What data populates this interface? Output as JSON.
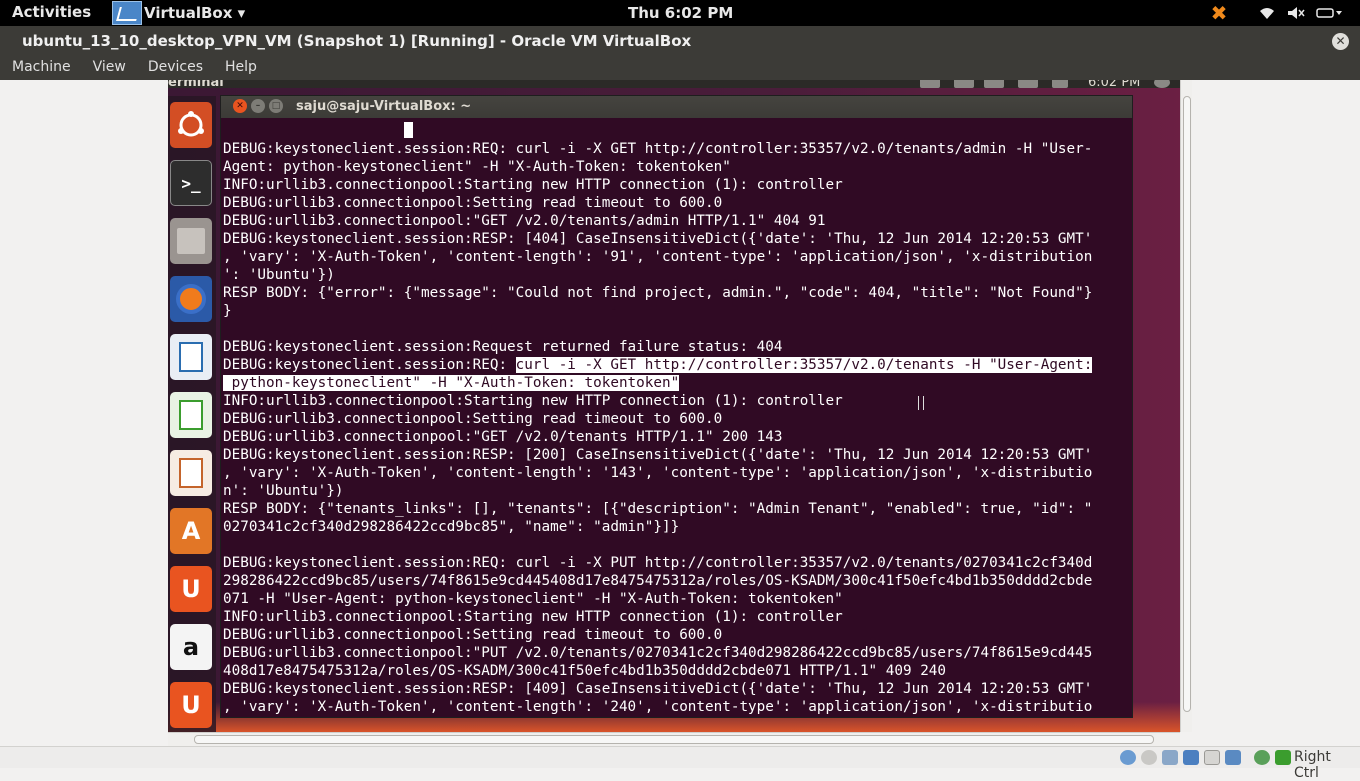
{
  "host_topbar": {
    "activities": "Activities",
    "app_name": "VirtualBox ▾",
    "clock": "Thu  6:02 PM"
  },
  "vbox_window": {
    "title": "ubuntu_13_10_desktop_VPN_VM (Snapshot 1) [Running] - Oracle VM VirtualBox",
    "close_glyph": "✕",
    "menu": [
      "Machine",
      "View",
      "Devices",
      "Help"
    ]
  },
  "guest": {
    "panel_text": "erminal",
    "clock": "6:02 PM",
    "launcher_icons": [
      "ubuntu-dash-icon",
      "terminal-icon",
      "files-icon",
      "firefox-icon",
      "writer-icon",
      "calc-icon",
      "impress-icon",
      "software-center-icon",
      "ubuntu-one-icon",
      "amazon-icon",
      "ubuntu-one-music-icon"
    ]
  },
  "terminal": {
    "title": "saju@saju-VirtualBox: ~",
    "close_glyph": "✕",
    "min_glyph": "–",
    "max_glyph": "□",
    "lines": [
      "DEBUG:keystoneclient.session:REQ: curl -i -X GET http://controller:35357/v2.0/tenants/admin -H \"User-",
      "Agent: python-keystoneclient\" -H \"X-Auth-Token: tokentoken\"",
      "INFO:urllib3.connectionpool:Starting new HTTP connection (1): controller",
      "DEBUG:urllib3.connectionpool:Setting read timeout to 600.0",
      "DEBUG:urllib3.connectionpool:\"GET /v2.0/tenants/admin HTTP/1.1\" 404 91",
      "DEBUG:keystoneclient.session:RESP: [404] CaseInsensitiveDict({'date': 'Thu, 12 Jun 2014 12:20:53 GMT'",
      ", 'vary': 'X-Auth-Token', 'content-length': '91', 'content-type': 'application/json', 'x-distribution",
      "': 'Ubuntu'})",
      "RESP BODY: {\"error\": {\"message\": \"Could not find project, admin.\", \"code\": 404, \"title\": \"Not Found\"}",
      "}",
      "",
      "DEBUG:keystoneclient.session:Request returned failure status: 404"
    ],
    "highlight_prefix": "DEBUG:keystoneclient.session:REQ: ",
    "highlight_1": "curl -i -X GET http://controller:35357/v2.0/tenants -H \"User-Agent:",
    "highlight_2": " python-keystoneclient\" -H \"X-Auth-Token: tokentoken\"",
    "lines_after": [
      "INFO:urllib3.connectionpool:Starting new HTTP connection (1): controller",
      "DEBUG:urllib3.connectionpool:Setting read timeout to 600.0",
      "DEBUG:urllib3.connectionpool:\"GET /v2.0/tenants HTTP/1.1\" 200 143",
      "DEBUG:keystoneclient.session:RESP: [200] CaseInsensitiveDict({'date': 'Thu, 12 Jun 2014 12:20:53 GMT'",
      ", 'vary': 'X-Auth-Token', 'content-length': '143', 'content-type': 'application/json', 'x-distributio",
      "n': 'Ubuntu'})",
      "RESP BODY: {\"tenants_links\": [], \"tenants\": [{\"description\": \"Admin Tenant\", \"enabled\": true, \"id\": \"",
      "0270341c2cf340d298286422ccd9bc85\", \"name\": \"admin\"}]}",
      "",
      "DEBUG:keystoneclient.session:REQ: curl -i -X PUT http://controller:35357/v2.0/tenants/0270341c2cf340d",
      "298286422ccd9bc85/users/74f8615e9cd445408d17e8475475312a/roles/OS-KSADM/300c41f50efc4bd1b350dddd2cbde",
      "071 -H \"User-Agent: python-keystoneclient\" -H \"X-Auth-Token: tokentoken\"",
      "INFO:urllib3.connectionpool:Starting new HTTP connection (1): controller",
      "DEBUG:urllib3.connectionpool:Setting read timeout to 600.0",
      "DEBUG:urllib3.connectionpool:\"PUT /v2.0/tenants/0270341c2cf340d298286422ccd9bc85/users/74f8615e9cd445",
      "408d17e8475475312a/roles/OS-KSADM/300c41f50efc4bd1b350dddd2cbde071 HTTP/1.1\" 409 240",
      "DEBUG:keystoneclient.session:RESP: [409] CaseInsensitiveDict({'date': 'Thu, 12 Jun 2014 12:20:53 GMT'",
      ", 'vary': 'X-Auth-Token', 'content-length': '240', 'content-type': 'application/json', 'x-distributio"
    ]
  },
  "statusbar": {
    "host_key": "Right Ctrl"
  },
  "colors": {
    "terminal_bg": "#300a24",
    "panel_bg": "#3c3b37",
    "ubuntu_orange": "#e95420"
  }
}
